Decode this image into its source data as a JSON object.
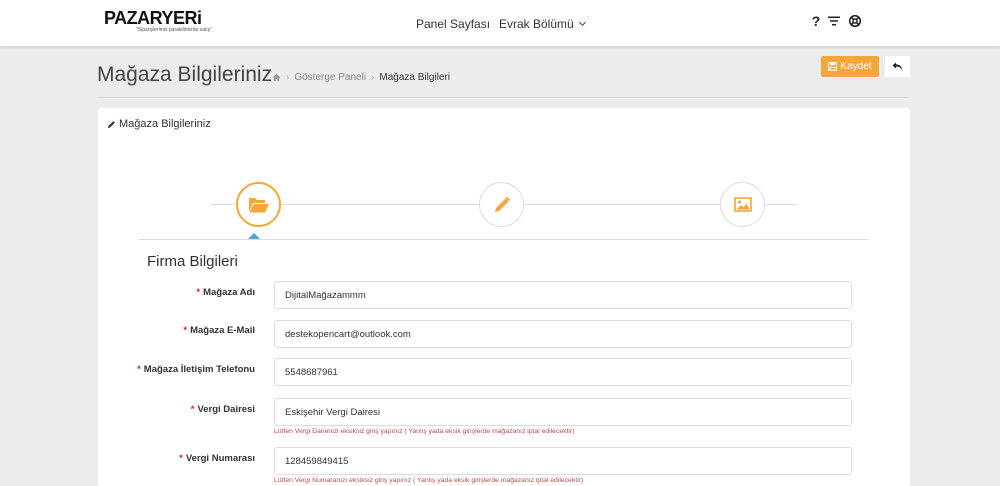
{
  "header": {
    "logo_text": "PAZARYERi",
    "logo_tagline": "\"Siparişlerimiz paralelimizde satış\"",
    "nav": [
      {
        "label": "Panel Sayfası"
      },
      {
        "label": "Evrak Bölümü"
      }
    ],
    "icons": {
      "help": "?",
      "help_icon": "question-icon",
      "filter_icon": "filter-icon",
      "support_icon": "lifebuoy-icon"
    }
  },
  "page": {
    "title": "Mağaza Bilgileriniz",
    "breadcrumb": [
      {
        "label": "Gösterge Paneli"
      },
      {
        "label": "Mağaza Bilgileri"
      }
    ],
    "save_label": "Kaydet"
  },
  "card": {
    "title": "Mağaza Bilgileriniz",
    "wizard": {
      "steps": [
        "folder-open-icon",
        "pencil-icon",
        "image-icon"
      ],
      "active_step": 1,
      "active_color": "#f5a638",
      "indicator_color": "#4aa8d8"
    },
    "section_title": "Firma Bilgileri",
    "fields": [
      {
        "label": "Mağaza Adı",
        "value": "DijitalMağazammm"
      },
      {
        "label": "Mağaza E-Mail",
        "value": "destekopencart@outlook.com"
      },
      {
        "label": "Mağaza İletişim Telefonu",
        "value": "5548687961"
      },
      {
        "label": "Vergi Dairesi",
        "value": "Eskişehir Vergi Dairesi",
        "help": "Lütfen Vergi Dairenizi eksiksiz giriş yapınız ( Yanlış yada eksik girişlerde mağazanız iptal edilecektir)"
      },
      {
        "label": "Vergi Numarası",
        "value": "128459849415",
        "help": "Lütfen Vergi Numaranızı eksiksiz giriş yapınız ( Yanlış yada eksik girişlerde mağazanız iptal edilecektir)"
      }
    ],
    "required_mark": "*"
  },
  "colors": {
    "accent": "#f5a638",
    "error": "#b94a48",
    "required": "#d9232d"
  }
}
